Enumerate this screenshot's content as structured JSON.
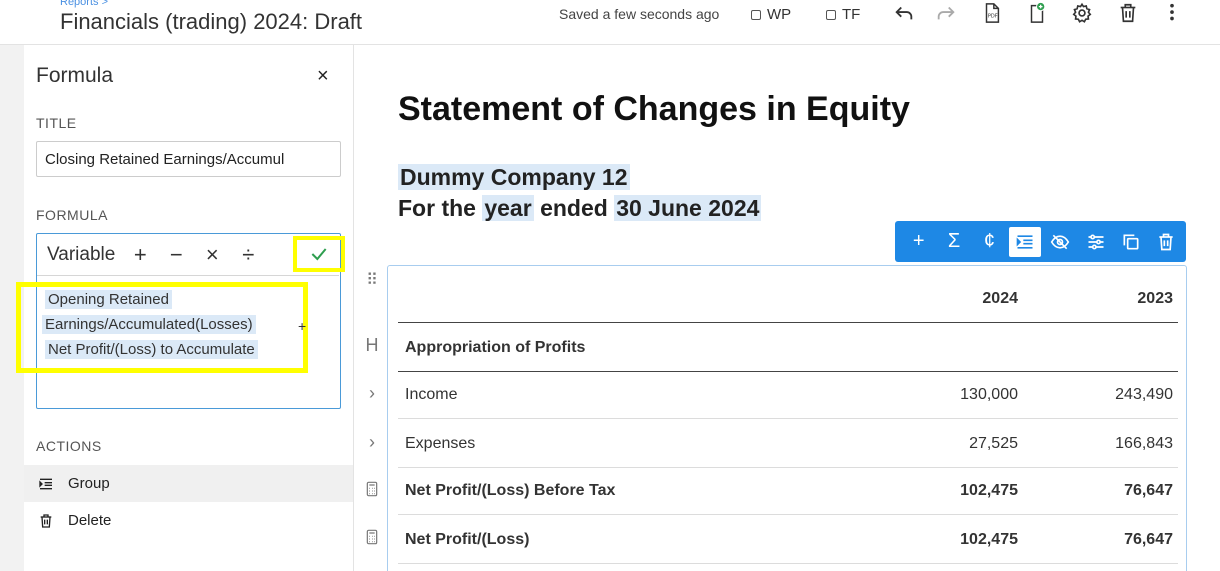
{
  "header": {
    "breadcrumb": "Reports >",
    "title": "Financials (trading) 2024: Draft",
    "saved_status": "Saved a few seconds ago",
    "checkbox_wp": "WP",
    "checkbox_tf": "TF",
    "icons": [
      "undo-icon",
      "redo-icon",
      "pdf-icon",
      "add-document-icon",
      "gear-icon",
      "trash-icon",
      "more-vertical-icon"
    ]
  },
  "panel": {
    "title": "Formula",
    "close": "×",
    "title_label": "TITLE",
    "title_value": "Closing Retained Earnings/Accumul",
    "formula_label": "FORMULA",
    "toolbar": {
      "variable": "Variable",
      "plus": "+",
      "minus": "−",
      "times": "×",
      "divide": "÷"
    },
    "formula_terms": {
      "term1_line1": "Opening Retained",
      "term1_line2": "Earnings/Accumulated(Losses)",
      "operator": "+",
      "term2": "Net Profit/(Loss) to Accumulate"
    },
    "actions_label": "ACTIONS",
    "actions": [
      {
        "label": "Group",
        "icon": "indent-icon"
      },
      {
        "label": "Delete",
        "icon": "trash-icon"
      }
    ]
  },
  "report": {
    "title": "Statement of Changes in Equity",
    "company": "Dummy Company 12",
    "period_prefix": "For the",
    "period_word": "year",
    "period_mid": "ended",
    "period_date": "30 June 2024",
    "toolbar_icons": [
      "plus-icon",
      "sigma-icon",
      "currency-icon",
      "indent-icon",
      "hide-icon",
      "sliders-icon",
      "copy-icon",
      "trash-icon"
    ],
    "toolbar_glyphs": {
      "plus": "+",
      "sigma": "Σ",
      "currency": "¢"
    },
    "columns": [
      "2024",
      "2023"
    ],
    "section_marker": "H",
    "section_heading": "Appropriation of Profits",
    "rows": [
      {
        "label": "Income",
        "v2024": "130,000",
        "v2023": "243,490",
        "bold": false
      },
      {
        "label": "Expenses",
        "v2024": "27,525",
        "v2023": "166,843",
        "bold": false
      },
      {
        "label": "Net Profit/(Loss) Before Tax",
        "v2024": "102,475",
        "v2023": "76,647",
        "bold": true
      },
      {
        "label": "Net Profit/(Loss)",
        "v2024": "102,475",
        "v2023": "76,647",
        "bold": true
      }
    ]
  },
  "colors": {
    "accent": "#1e88e5",
    "highlight": "#dbe9f7",
    "annotation_yellow": "#ffff00",
    "check_green": "#2e9e4f"
  }
}
